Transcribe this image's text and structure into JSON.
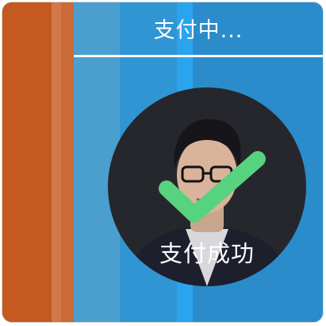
{
  "header": {
    "title": "支付中..."
  },
  "status": {
    "label": "支付成功",
    "icon": "check-icon"
  },
  "avatar": {
    "icon": "user-avatar"
  },
  "colors": {
    "background_blue": "#2e8fcd",
    "side_orange": "#c45a20",
    "avatar_bg": "#26272c",
    "check_green": "#57d27f",
    "text": "#ffffff"
  }
}
